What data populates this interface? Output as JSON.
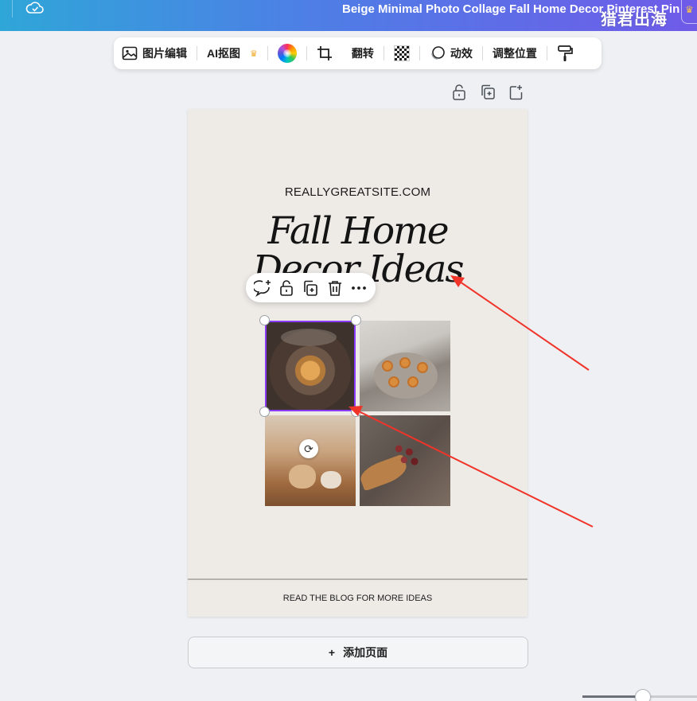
{
  "topbar": {
    "document_title": "Beige Minimal Photo Collage Fall Home Decor Pinterest Pin",
    "watermark": "猎君出海",
    "crown_glyph": "♛",
    "icons": [
      "cloud-check-icon"
    ]
  },
  "toolbar": {
    "image_edit_label": "图片编辑",
    "ai_cutout_label": "AI抠图",
    "crown_glyph": "♛",
    "flip_label": "翻转",
    "animate_label": "动效",
    "position_label": "调整位置",
    "icons": [
      "image-edit-icon",
      "color-wheel-icon",
      "crop-icon",
      "transparency-icon",
      "animate-icon",
      "paint-roller-icon"
    ]
  },
  "page_actions": {
    "icons": [
      "lock-icon",
      "duplicate-page-icon",
      "add-page-icon"
    ]
  },
  "design": {
    "site": "REALLYGREATSITE.COM",
    "headline_line1": "Fall Home",
    "headline_line2": "Decor Ideas",
    "footer": "READ THE BLOG FOR MORE IDEAS",
    "background": "#eeebe7"
  },
  "context_menu": {
    "icons": [
      "comment-add-icon",
      "lock-icon",
      "duplicate-icon",
      "trash-icon",
      "more-icon"
    ]
  },
  "selection": {
    "color": "#8b3dff",
    "rotate_glyph": "⟳"
  },
  "annotation": {
    "arrow_color": "#f0342a"
  },
  "add_page": {
    "plus": "+",
    "label": "添加页面"
  },
  "zoom": {
    "level_fraction": 0.53
  }
}
